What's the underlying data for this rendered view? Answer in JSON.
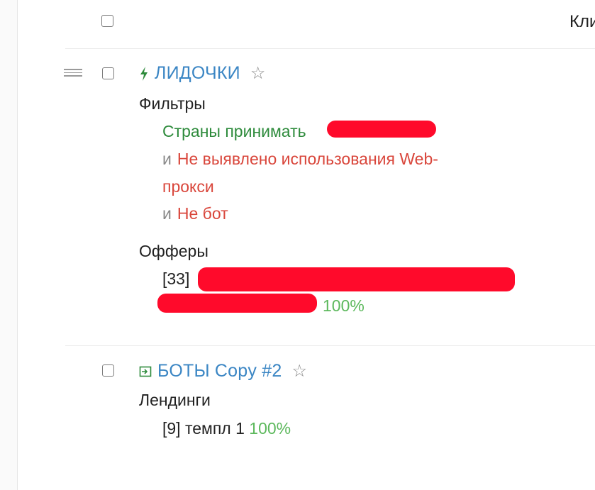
{
  "header": {
    "column_label": "Кли"
  },
  "rules": [
    {
      "name": "ЛИДОЧКИ",
      "icon": "bolt-icon",
      "filters_label": "Фильтры",
      "filters": [
        {
          "conjunction": "",
          "text": "Страны принимать",
          "color": "#2e8b3c"
        },
        {
          "conjunction": "и",
          "text": "Не выявлено использования Web-",
          "color": "#d9463b"
        },
        {
          "conjunction": "",
          "text": "прокси",
          "color": "#d9463b"
        },
        {
          "conjunction": "и",
          "text": "Не бот",
          "color": "#d9463b"
        }
      ],
      "offers_label": "Офферы",
      "offers": [
        {
          "id": "[33]",
          "share": ""
        },
        {
          "id": "",
          "share": "100%"
        }
      ]
    },
    {
      "name": "БОТЫ Copy #2",
      "icon": "login-arrow-icon",
      "landings_label": "Лендинги",
      "landings": [
        {
          "id": "[9]",
          "name": "темпл 1",
          "share": "100%"
        }
      ]
    }
  ],
  "colors": {
    "link": "#3b86c4",
    "accent_green": "#2e8b3c",
    "negative_red": "#d9463b",
    "percent_green": "#5cb85c",
    "redaction": "#ff0a2b"
  }
}
